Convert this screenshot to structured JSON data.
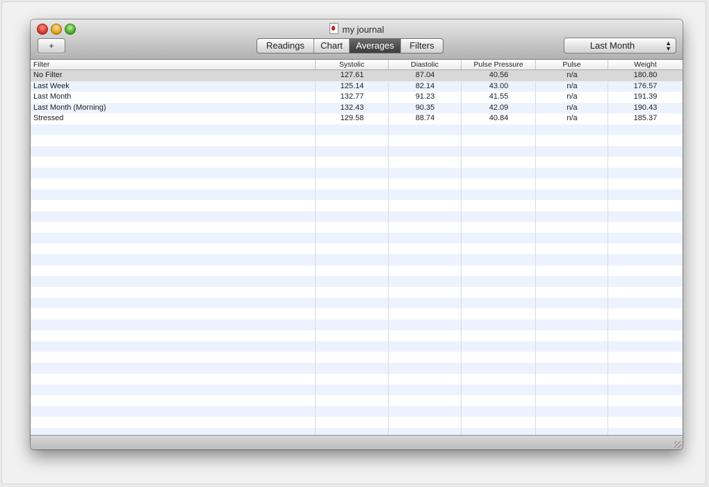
{
  "window": {
    "title": "my journal"
  },
  "toolbar": {
    "add_label": "+",
    "tabs": [
      {
        "label": "Readings",
        "active": false
      },
      {
        "label": "Chart",
        "active": false
      },
      {
        "label": "Averages",
        "active": true
      },
      {
        "label": "Filters",
        "active": false
      }
    ],
    "period_select": {
      "value": "Last Month"
    }
  },
  "table": {
    "columns": [
      "Filter",
      "Systolic",
      "Diastolic",
      "Pulse Pressure",
      "Pulse",
      "Weight"
    ],
    "rows": [
      {
        "filter": "No Filter",
        "systolic": "127.61",
        "diastolic": "87.04",
        "pulse_pressure": "40.56",
        "pulse": "n/a",
        "weight": "180.80",
        "selected": true
      },
      {
        "filter": "Last Week",
        "systolic": "125.14",
        "diastolic": "82.14",
        "pulse_pressure": "43.00",
        "pulse": "n/a",
        "weight": "176.57",
        "selected": false
      },
      {
        "filter": "Last Month",
        "systolic": "132.77",
        "diastolic": "91.23",
        "pulse_pressure": "41.55",
        "pulse": "n/a",
        "weight": "191.39",
        "selected": false
      },
      {
        "filter": "Last Month (Morning)",
        "systolic": "132.43",
        "diastolic": "90.35",
        "pulse_pressure": "42.09",
        "pulse": "n/a",
        "weight": "190.43",
        "selected": false
      },
      {
        "filter": "Stressed",
        "systolic": "129.58",
        "diastolic": "88.74",
        "pulse_pressure": "40.84",
        "pulse": "n/a",
        "weight": "185.37",
        "selected": false
      }
    ]
  },
  "colors": {
    "stripe": "#edf3fe",
    "selected_row": "#d8d8d8",
    "active_tab": "#4e4e4e",
    "close_button": "#d8392e",
    "minimize_button": "#e2a21c",
    "zoom_button": "#4eac2c"
  },
  "icons": [
    "close-window-icon",
    "minimize-window-icon",
    "zoom-window-icon",
    "document-proxy-icon",
    "popup-arrows-icon",
    "resize-grip-icon"
  ]
}
